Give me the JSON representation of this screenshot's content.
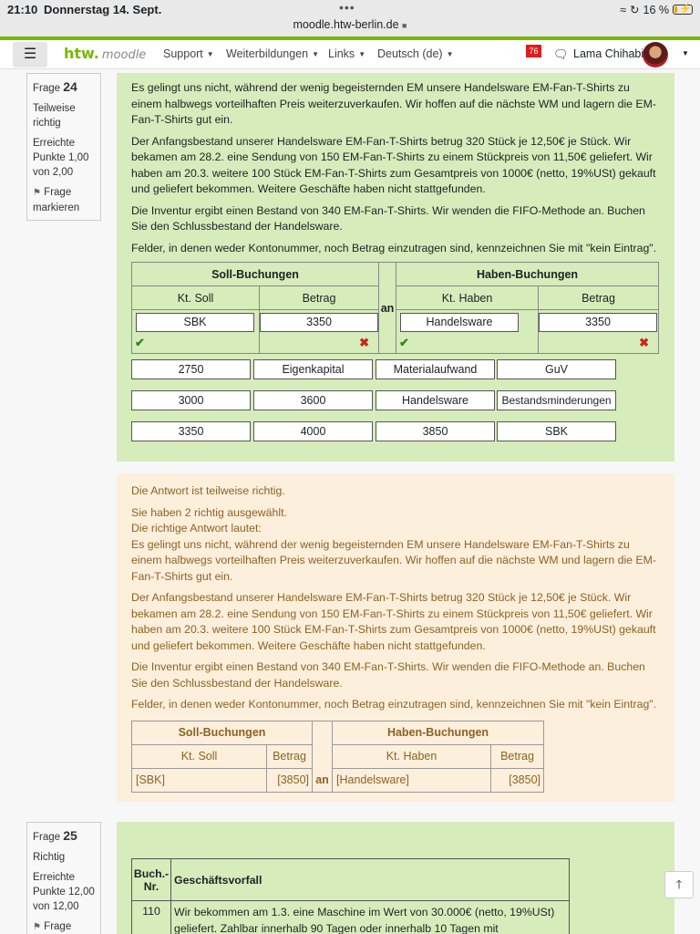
{
  "status_bar": {
    "time": "21:10",
    "date": "Donnerstag 14. Sept.",
    "url": "moodle.htw-berlin.de",
    "battery": "16 %",
    "battery_fraction": 0.16
  },
  "navbar": {
    "logo_main": "htw.",
    "logo_sub": "moodle",
    "items": [
      "Support",
      "Weiterbildungen",
      "Links",
      "Deutsch (de)"
    ],
    "notifications": "76",
    "user": "Lama Chihabi"
  },
  "q24": {
    "label": "Frage",
    "number": "24",
    "state": "Teilweise richtig",
    "grade": "Erreichte Punkte 1,00 von 2,00",
    "flag": "Frage markieren",
    "para1": "Es gelingt uns nicht, während der wenig begeisternden EM unsere Handelsware EM-Fan-T-Shirts zu einem halbwegs vorteilhaften Preis weiterzuverkaufen. Wir hoffen auf die nächste WM und lagern die EM-Fan-T-Shirts gut ein.",
    "para2": "Der Anfangsbestand unserer Handelsware EM-Fan-T-Shirts betrug 320 Stück je 12,50€ je Stück. Wir bekamen am 28.2. eine Sendung von 150 EM-Fan-T-Shirts zu einem Stückpreis von 11,50€ geliefert. Wir haben am 20.3. weitere 100 Stück EM-Fan-T-Shirts zum Gesamtpreis von 1000€ (netto, 19%USt) gekauft und geliefert bekommen. Weitere Geschäfte haben nicht stattgefunden.",
    "para3": "Die Inventur ergibt einen Bestand von 340 EM-Fan-T-Shirts. Wir wenden die FIFO-Methode an. Buchen Sie den Schlussbestand der Handelsware.",
    "para4": "Felder, in denen weder Kontonummer, noch Betrag einzutragen sind, kennzeichnen Sie mit \"kein Eintrag\".",
    "table": {
      "soll_header": "Soll-Buchungen",
      "haben_header": "Haben-Buchungen",
      "kt_soll": "Kt. Soll",
      "betrag": "Betrag",
      "kt_haben": "Kt. Haben",
      "an": "an",
      "soll_konto": "SBK",
      "soll_betrag": "3350",
      "haben_konto": "Handelsware",
      "haben_betrag": "3350"
    },
    "choices": [
      [
        "2750",
        "Eigenkapital",
        "Materialaufwand",
        "GuV"
      ],
      [
        "3000",
        "3600",
        "Handelsware",
        "Bestandsminderungen"
      ],
      [
        "3350",
        "4000",
        "3850",
        "SBK"
      ]
    ]
  },
  "feedback": {
    "partial": "Die Antwort ist teilweise richtig.",
    "selected": "Sie haben 2 richtig ausgewählt.",
    "correct_label": "Die richtige Antwort lautet:",
    "para1": "Es gelingt uns nicht, während der wenig begeisternden EM unsere Handelsware EM-Fan-T-Shirts zu einem halbwegs vorteilhaften Preis weiterzuverkaufen. Wir hoffen auf die nächste WM und lagern die EM-Fan-T-Shirts gut ein.",
    "para2": "Der Anfangsbestand unserer Handelsware EM-Fan-T-Shirts betrug 320 Stück je 12,50€ je Stück. Wir bekamen am 28.2. eine Sendung von 150 EM-Fan-T-Shirts zu einem Stückpreis von 11,50€ geliefert. Wir haben am 20.3. weitere 100 Stück EM-Fan-T-Shirts zum Gesamtpreis von 1000€ (netto, 19%USt) gekauft und geliefert bekommen. Weitere Geschäfte haben nicht stattgefunden.",
    "para3": "Die Inventur ergibt einen Bestand von 340 EM-Fan-T-Shirts. Wir wenden die FIFO-Methode an. Buchen Sie den Schlussbestand der Handelsware.",
    "para4": "Felder, in denen weder Kontonummer, noch Betrag einzutragen sind, kennzeichnen Sie mit \"kein Eintrag\".",
    "table": {
      "soll_header": "Soll-Buchungen",
      "haben_header": "Haben-Buchungen",
      "kt_soll": "Kt. Soll",
      "betrag": "Betrag",
      "kt_haben": "Kt. Haben",
      "an": "an",
      "soll_konto": "[SBK]",
      "soll_betrag": "[3850]",
      "haben_konto": "[Handelsware]",
      "haben_betrag": "[3850]"
    }
  },
  "q25": {
    "label": "Frage",
    "number": "25",
    "state": "Richtig",
    "grade": "Erreichte Punkte 12,00 von 12,00",
    "flag": "Frage",
    "col1": "Buch.-Nr.",
    "col2": "Geschäftsvorfall",
    "row_nr": "110",
    "row_text": "Wir bekommen am 1.3. eine Maschine im Wert von 30.000€ (netto, 19%USt) geliefert. Zahlbar innerhalb 90 Tagen oder innerhalb 10 Tagen mit"
  },
  "icons": {
    "to_top": "arrow-up-icon",
    "check": "check-icon",
    "cross": "cross-icon"
  }
}
